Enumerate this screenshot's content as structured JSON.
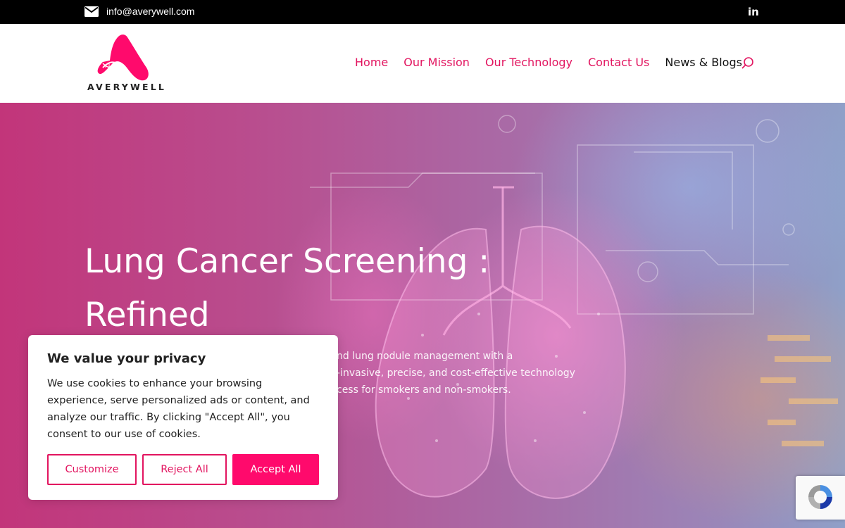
{
  "topbar": {
    "email": "info@averywell.com",
    "mail_icon": "mail-icon",
    "social_icon": "linkedin-icon",
    "social_label": "in"
  },
  "header": {
    "logo_text": "AVERYWELL",
    "nav": [
      {
        "label": "Home"
      },
      {
        "label": "Our Mission"
      },
      {
        "label": "Our Technology"
      },
      {
        "label": "Contact Us"
      },
      {
        "label": "News & Blogs"
      }
    ],
    "search_icon": "search-icon"
  },
  "hero": {
    "title_line1": "Lung Cancer Screening :",
    "title_line2": "Refined",
    "text_line1": "nd lung nodule management with a",
    "text_line2": "-invasive, precise, and cost-effective technology",
    "text_line3": "cess for smokers and non-smokers."
  },
  "cookie": {
    "title": "We value your privacy",
    "body": "We use cookies to enhance your browsing experience, serve personalized ads or content, and analyze our traffic. By clicking \"Accept All\", you consent to our use of cookies.",
    "customize_label": "Customize",
    "reject_label": "Reject All",
    "accept_label": "Accept All"
  },
  "recaptcha": {
    "icon": "recaptcha-icon"
  },
  "colors": {
    "brand": "#e2145f",
    "accept_button": "#ff0a6c",
    "topbar": "#000000"
  }
}
